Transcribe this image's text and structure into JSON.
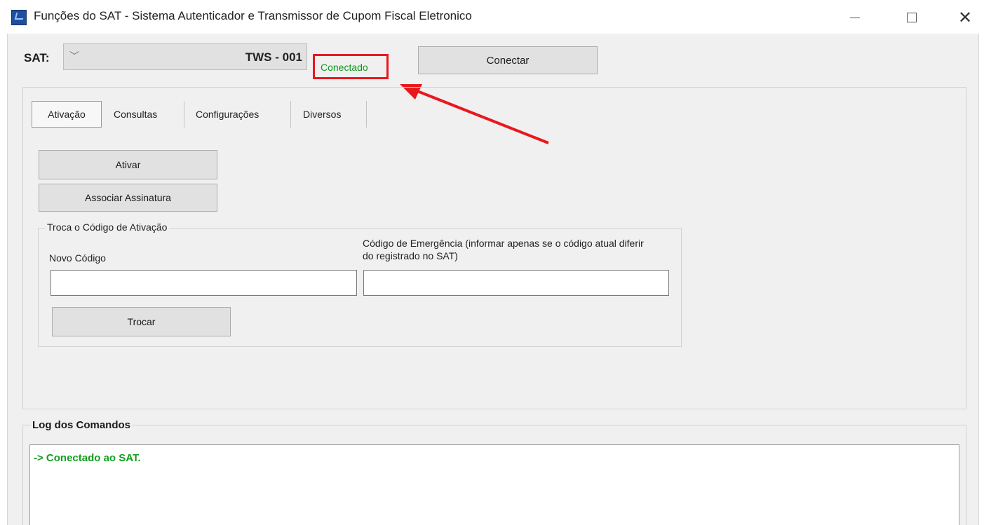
{
  "window": {
    "title": "Funções do SAT - Sistema Autenticador e Transmissor de Cupom Fiscal Eletronico"
  },
  "header": {
    "sat_label": "SAT:",
    "sat_selected": "TWS - 001",
    "status": "Conectado",
    "connect_label": "Conectar"
  },
  "tabs": [
    {
      "label": "Ativação",
      "active": true
    },
    {
      "label": "Consultas",
      "active": false
    },
    {
      "label": "Configurações",
      "active": false
    },
    {
      "label": "Diversos",
      "active": false
    }
  ],
  "ativacao": {
    "ativar_label": "Ativar",
    "associar_label": "Associar Assinatura",
    "group_title": "Troca o Código de Ativação",
    "novo_codigo_label": "Novo Código",
    "novo_codigo_value": "",
    "emergencia_label": "Código de Emergência (informar apenas se o código atual diferir do registrado no SAT)",
    "emergencia_value": "",
    "trocar_label": "Trocar"
  },
  "log": {
    "title": "Log dos Comandos",
    "lines": [
      "-> Conectado ao SAT."
    ]
  },
  "colors": {
    "status_text": "#0e9a1a",
    "highlight_box": "#e8191d",
    "annotation_arrow": "#e8191d",
    "log_text": "#12a01e"
  },
  "icons": {
    "app": "sat-app-icon",
    "minimize": "minimize-icon",
    "maximize": "maximize-icon",
    "close": "close-icon",
    "dropdown": "chevron-down-icon"
  }
}
